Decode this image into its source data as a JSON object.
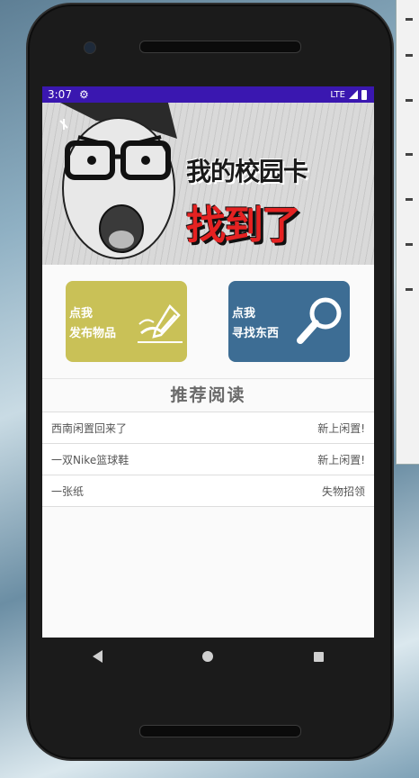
{
  "status_bar": {
    "time": "3:07",
    "network": "LTE"
  },
  "banner": {
    "line1": "我的校园卡",
    "line2": "找到了"
  },
  "actions": {
    "publish": {
      "line1": "点我",
      "line2": "发布物品"
    },
    "find": {
      "line1": "点我",
      "line2": "寻找东西"
    }
  },
  "section": {
    "title": "推荐阅读"
  },
  "list": [
    {
      "title": "西南闲置回来了",
      "tag": "新上闲置!"
    },
    {
      "title": "一双Nike篮球鞋",
      "tag": "新上闲置!"
    },
    {
      "title": "一张纸",
      "tag": "失物招领"
    }
  ],
  "colors": {
    "statusbar": "#3a17b0",
    "publish": "#c9c157",
    "find": "#3d6d94",
    "headline_red": "#e52222"
  }
}
